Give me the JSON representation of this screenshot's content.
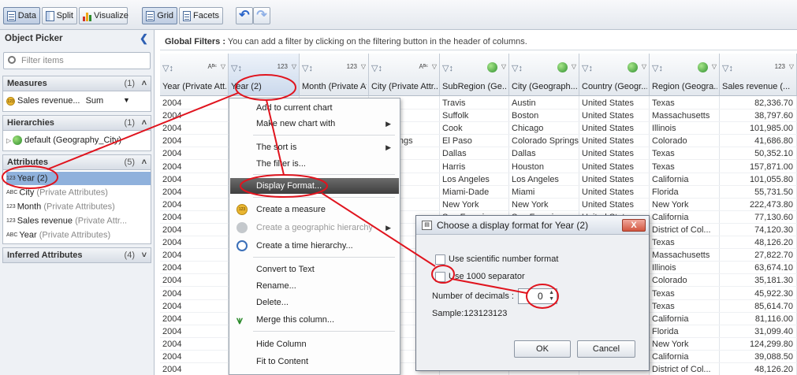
{
  "toolbar": {
    "data_label": "Data",
    "split_label": "Split",
    "visualize_label": "Visualize",
    "grid_label": "Grid",
    "facets_label": "Facets"
  },
  "object_picker": {
    "title": "Object Picker",
    "filter_placeholder": "Filter items",
    "measures": {
      "title": "Measures",
      "count": "(1)",
      "item": "Sales revenue...",
      "aggregation": "Sum"
    },
    "hierarchies": {
      "title": "Hierarchies",
      "count": "(1)",
      "item": "default (Geography_City)"
    },
    "attributes": {
      "title": "Attributes",
      "count": "(5)",
      "items": [
        {
          "name": "Year (2)",
          "suffix": ""
        },
        {
          "name": "City",
          "suffix": "(Private Attributes)"
        },
        {
          "name": "Month",
          "suffix": "(Private Attributes)"
        },
        {
          "name": "Sales revenue",
          "suffix": "(Private Attr..."
        },
        {
          "name": "Year",
          "suffix": "(Private Attributes)"
        }
      ]
    },
    "inferred": {
      "title": "Inferred Attributes",
      "count": "(4)"
    }
  },
  "global_filters": {
    "label": "Global Filters :",
    "hint": "You can add a filter by clicking on the filtering button in the header of columns."
  },
  "grid": {
    "columns": [
      {
        "label": "Year (Private Att...",
        "type": "ABC"
      },
      {
        "label": "Year (2)",
        "type": "123"
      },
      {
        "label": "Month (Private At...",
        "type": "123"
      },
      {
        "label": "City (Private Attr...",
        "type": "ABC"
      },
      {
        "label": "SubRegion (Ge...",
        "type": "globe"
      },
      {
        "label": "City (Geograph...",
        "type": "globe"
      },
      {
        "label": "Country (Geogr...",
        "type": "globe"
      },
      {
        "label": "Region (Geogra...",
        "type": "globe"
      },
      {
        "label": "Sales revenue (...",
        "type": "123"
      }
    ],
    "rows": [
      [
        "2004",
        "",
        "",
        "",
        "Travis",
        "Austin",
        "United States",
        "Texas",
        "82,336.70"
      ],
      [
        "2004",
        "",
        "",
        "",
        "Suffolk",
        "Boston",
        "United States",
        "Massachusetts",
        "38,797.60"
      ],
      [
        "2004",
        "",
        "",
        "o",
        "Cook",
        "Chicago",
        "United States",
        "Illinois",
        "101,985.00"
      ],
      [
        "2004",
        "",
        "",
        "do Springs",
        "El Paso",
        "Colorado Springs",
        "United States",
        "Colorado",
        "41,686.80"
      ],
      [
        "2004",
        "",
        "",
        "",
        "Dallas",
        "Dallas",
        "United States",
        "Texas",
        "50,352.10"
      ],
      [
        "2004",
        "",
        "",
        "n",
        "Harris",
        "Houston",
        "United States",
        "Texas",
        "157,871.00"
      ],
      [
        "2004",
        "",
        "",
        "ngeles",
        "Los Angeles",
        "Los Angeles",
        "United States",
        "California",
        "101,055.80"
      ],
      [
        "2004",
        "",
        "",
        "",
        "Miami-Dade",
        "Miami",
        "United States",
        "Florida",
        "55,731.50"
      ],
      [
        "2004",
        "",
        "",
        "ork",
        "New York",
        "New York",
        "United States",
        "New York",
        "222,473.80"
      ],
      [
        "2004",
        "",
        "",
        "ncis",
        "San Francisco",
        "San Francisco",
        "United States",
        "California",
        "77,130.60"
      ],
      [
        "2004",
        "",
        "",
        "ngto",
        "",
        "",
        "",
        "District of Col...",
        "74,120.30"
      ],
      [
        "2004",
        "",
        "",
        "",
        "",
        "",
        "",
        "Texas",
        "48,126.20"
      ],
      [
        "2004",
        "",
        "",
        "",
        "",
        "",
        "",
        "Massachusetts",
        "27,822.70"
      ],
      [
        "2004",
        "",
        "",
        "",
        "",
        "",
        "",
        "Illinois",
        "63,674.10"
      ],
      [
        "2004",
        "",
        "",
        "o Sp",
        "",
        "",
        "",
        "Colorado",
        "35,181.30"
      ],
      [
        "2004",
        "",
        "",
        "",
        "",
        "",
        "",
        "Texas",
        "45,922.30"
      ],
      [
        "2004",
        "",
        "",
        "",
        "",
        "",
        "",
        "Texas",
        "85,614.70"
      ],
      [
        "2004",
        "",
        "",
        "ngele",
        "",
        "",
        "",
        "California",
        "81,116.00"
      ],
      [
        "2004",
        "",
        "",
        "",
        "",
        "",
        "",
        "Florida",
        "31,099.40"
      ],
      [
        "2004",
        "",
        "",
        "ork",
        "",
        "",
        "",
        "New York",
        "124,299.80"
      ],
      [
        "2004",
        "",
        "",
        "ncis",
        "",
        "",
        "",
        "California",
        "39,088.50"
      ],
      [
        "2004",
        "",
        "",
        "ngto",
        "",
        "",
        "",
        "District of Col...",
        "48,126.20"
      ]
    ]
  },
  "context_menu": {
    "items": [
      {
        "label": "Add to current chart",
        "submenu": false,
        "disabled": false,
        "icon": ""
      },
      {
        "label": "Make new chart with",
        "submenu": true,
        "disabled": false,
        "icon": ""
      },
      {
        "label": "The sort is",
        "submenu": true,
        "disabled": false,
        "icon": ""
      },
      {
        "label": "The filter is...",
        "submenu": false,
        "disabled": false,
        "icon": ""
      },
      {
        "label": "Display Format...",
        "submenu": false,
        "disabled": false,
        "icon": ""
      },
      {
        "label": "Create a measure",
        "submenu": false,
        "disabled": false,
        "icon": "measure-icon"
      },
      {
        "label": "Create a geographic hierarchy",
        "submenu": true,
        "disabled": true,
        "icon": "globe-icon"
      },
      {
        "label": "Create a time hierarchy...",
        "submenu": false,
        "disabled": false,
        "icon": "clock-icon"
      },
      {
        "label": "Convert to Text",
        "submenu": false,
        "disabled": false,
        "icon": ""
      },
      {
        "label": "Rename...",
        "submenu": false,
        "disabled": false,
        "icon": ""
      },
      {
        "label": "Delete...",
        "submenu": false,
        "disabled": false,
        "icon": ""
      },
      {
        "label": "Merge this column...",
        "submenu": false,
        "disabled": false,
        "icon": "merge-icon"
      },
      {
        "label": "Hide Column",
        "submenu": false,
        "disabled": false,
        "icon": ""
      },
      {
        "label": "Fit to Content",
        "submenu": false,
        "disabled": false,
        "icon": ""
      }
    ]
  },
  "dialog": {
    "title": "Choose a display format for Year (2)",
    "close_label": "X",
    "scientific_label": "Use scientific number format",
    "separator_label": "Use 1000 separator",
    "decimals_label": "Number of decimals :",
    "decimals_value": "0",
    "sample_label": "Sample:123123123",
    "ok_label": "OK",
    "cancel_label": "Cancel"
  },
  "colors": {
    "annotation": "#e0141e",
    "selection": "#8fb1dc",
    "menu_highlight": "#4a4a4a"
  }
}
